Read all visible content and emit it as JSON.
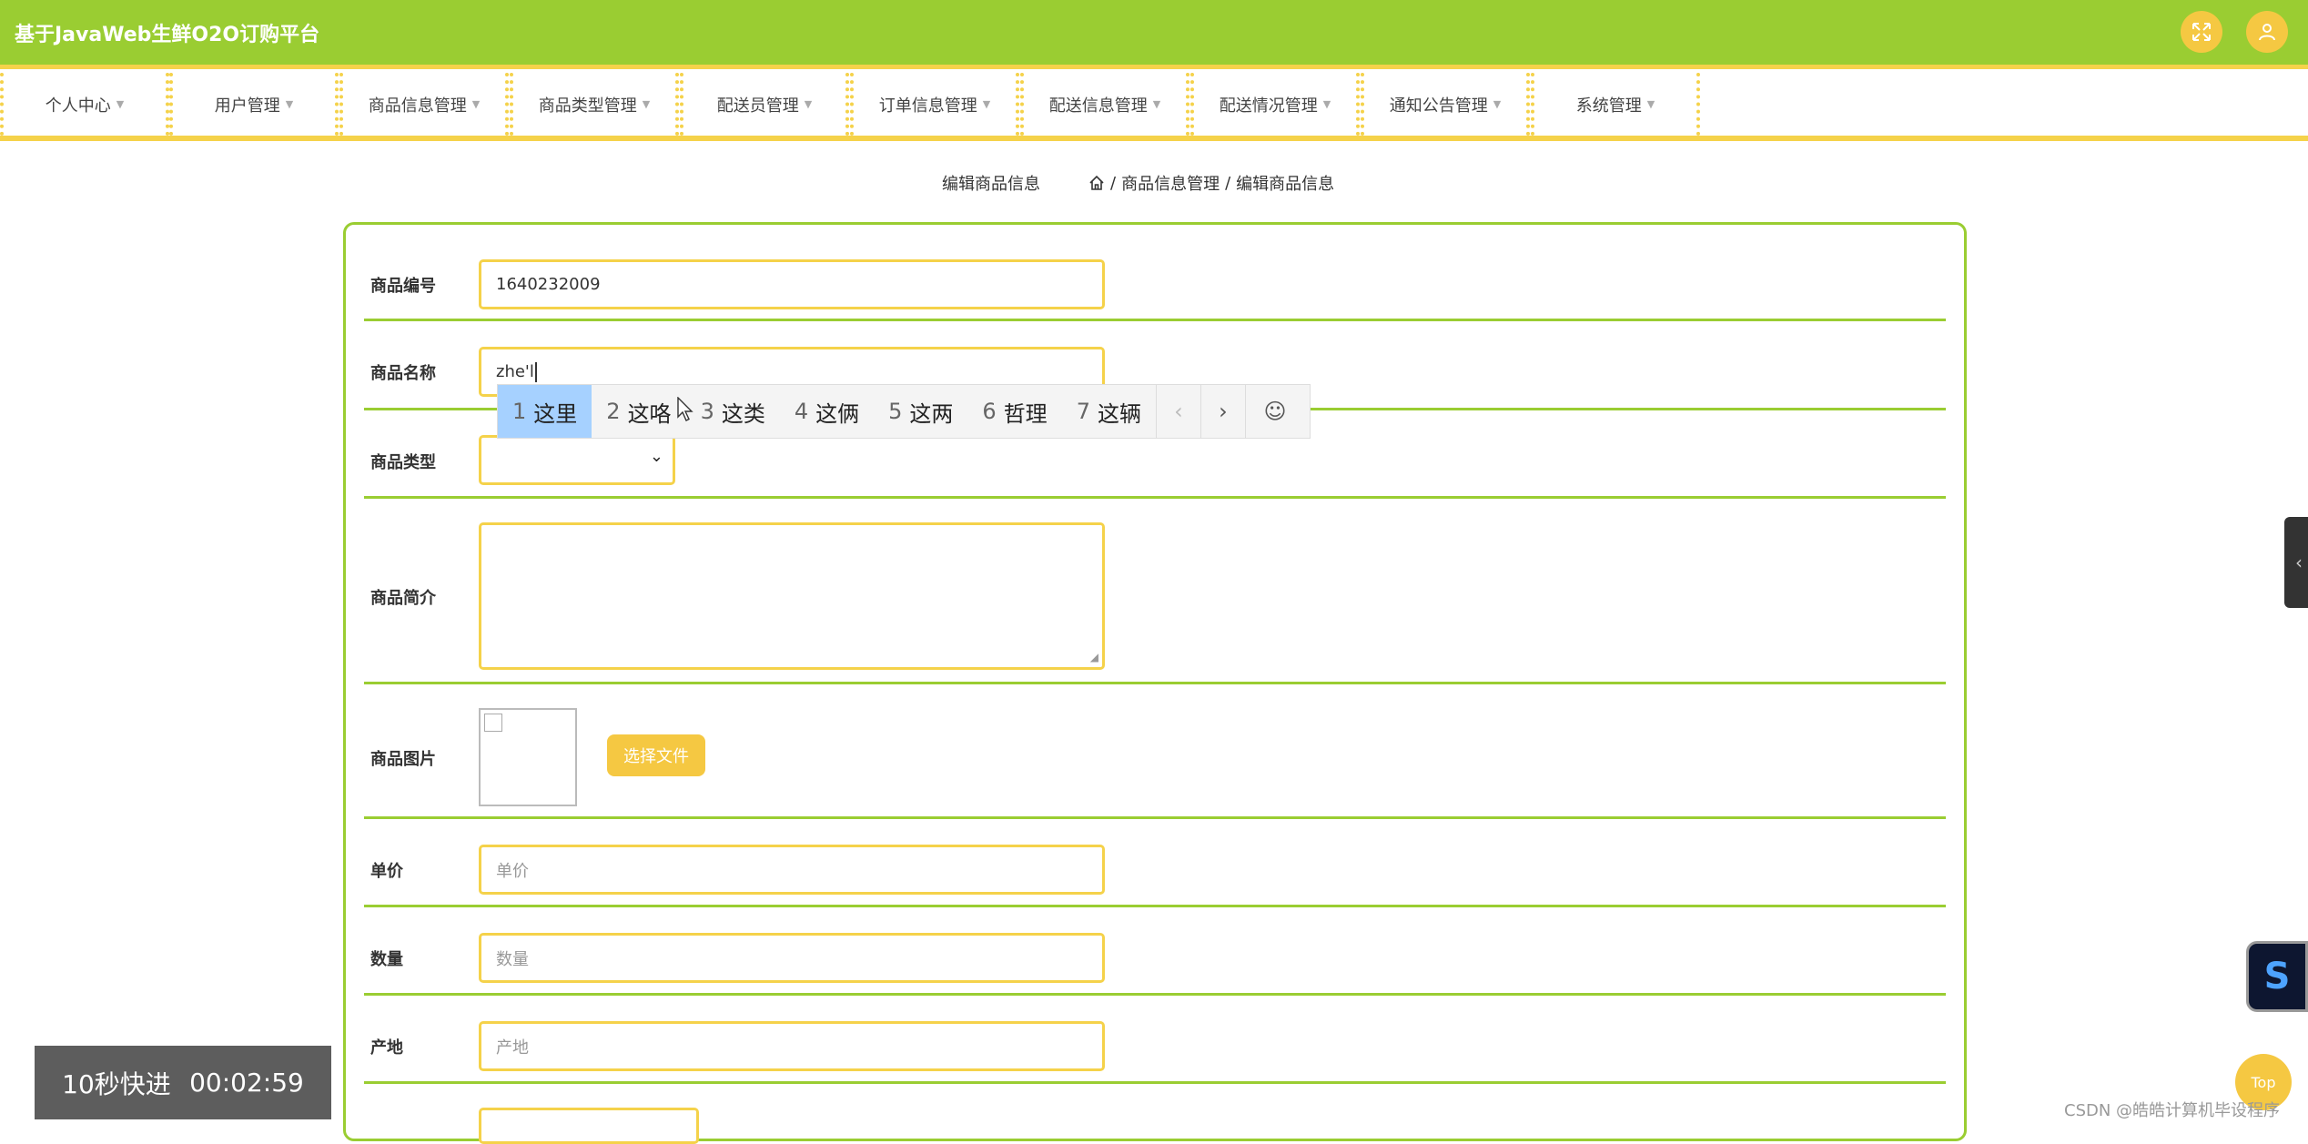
{
  "header": {
    "title": "基于JavaWeb生鲜O2O订购平台",
    "fullscreen_icon": "expand-icon",
    "user_icon": "user-icon"
  },
  "nav": {
    "items": [
      {
        "label": "个人中心"
      },
      {
        "label": "用户管理"
      },
      {
        "label": "商品信息管理"
      },
      {
        "label": "商品类型管理"
      },
      {
        "label": "配送员管理"
      },
      {
        "label": "订单信息管理"
      },
      {
        "label": "配送信息管理"
      },
      {
        "label": "配送情况管理"
      },
      {
        "label": "通知公告管理"
      },
      {
        "label": "系统管理"
      }
    ]
  },
  "breadcrumb": {
    "page_title": "编辑商品信息",
    "separator": "/",
    "section": "商品信息管理",
    "current": "编辑商品信息"
  },
  "form": {
    "product_code": {
      "label": "商品编号",
      "value": "1640232009"
    },
    "product_name": {
      "label": "商品名称",
      "value": "zhe'l"
    },
    "product_type": {
      "label": "商品类型",
      "value": ""
    },
    "product_desc": {
      "label": "商品简介",
      "value": ""
    },
    "product_image": {
      "label": "商品图片",
      "button": "选择文件"
    },
    "unit_price": {
      "label": "单价",
      "placeholder": "单价"
    },
    "quantity": {
      "label": "数量",
      "placeholder": "数量"
    },
    "origin": {
      "label": "产地",
      "placeholder": "产地"
    }
  },
  "ime": {
    "candidates": [
      {
        "num": "1",
        "text": "这里"
      },
      {
        "num": "2",
        "text": "这咯"
      },
      {
        "num": "3",
        "text": "这类"
      },
      {
        "num": "4",
        "text": "这俩"
      },
      {
        "num": "5",
        "text": "这两"
      },
      {
        "num": "6",
        "text": "哲理"
      },
      {
        "num": "7",
        "text": "这辆"
      }
    ],
    "prev": "‹",
    "next": "›",
    "emoji": "☺"
  },
  "overlay": {
    "video_label": "10秒快进",
    "video_time": "00:02:59",
    "top_button": "Top",
    "watermark": "CSDN @皓皓计算机毕设程序"
  },
  "colors": {
    "accent_green": "#9acd32",
    "accent_yellow": "#f5d24a"
  }
}
